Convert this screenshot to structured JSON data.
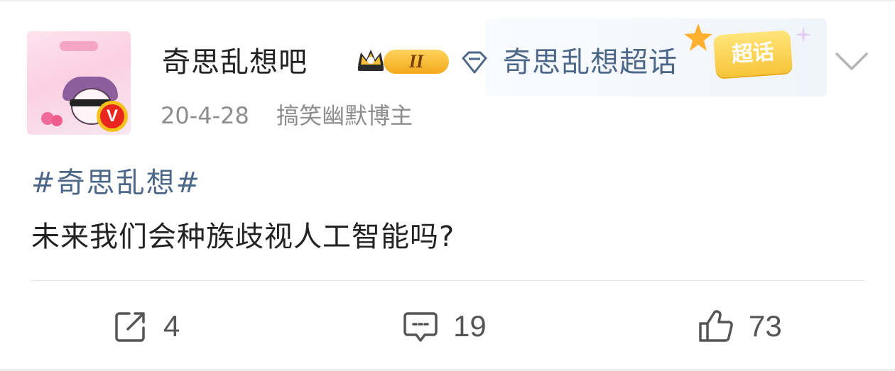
{
  "post": {
    "username": "奇思乱想吧",
    "level_badge": "II",
    "topic_name": "奇思乱想超话",
    "topic_badge": "超话",
    "date": "20-4-28",
    "user_category": "搞笑幽默博主",
    "hashtag": "#奇思乱想#",
    "text": "未来我们会种族歧视人工智能吗?",
    "verified_badge": "V"
  },
  "actions": {
    "repost_count": "4",
    "comment_count": "19",
    "like_count": "73"
  },
  "icons": [
    "avatar",
    "verified-badge",
    "crown-icon",
    "diamond-icon",
    "star-icon",
    "sparkle-icon",
    "chevron-down-icon",
    "repost-icon",
    "comment-icon",
    "like-icon"
  ],
  "colors": {
    "link_blue": "#4d6789",
    "text_dark": "#222222",
    "meta_gray": "#8d8d8d",
    "badge_gold": "#f7c53a",
    "verified_red": "#e8261f"
  }
}
